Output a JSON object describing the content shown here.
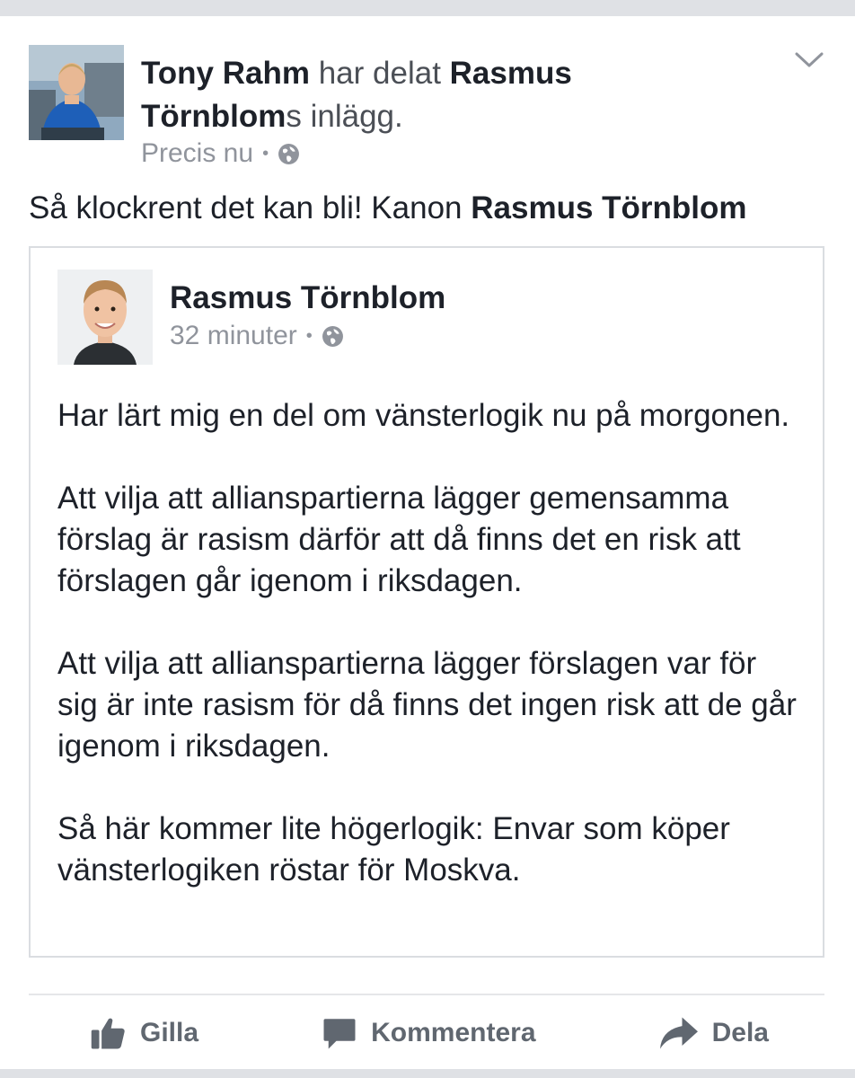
{
  "post": {
    "author": "Tony Rahm",
    "shared_word": " har delat ",
    "shared_from": "Rasmus Törnblom",
    "shared_suffix": "s inlägg.",
    "timestamp": "Precis nu",
    "dot": "•",
    "status_text": "Så klockrent det kan bli! Kanon ",
    "status_mention": "Rasmus Törnblom",
    "privacy_icon": "globe-icon",
    "menu_icon": "chevron-down-icon"
  },
  "shared_post": {
    "author": "Rasmus Törnblom",
    "timestamp": "32 minuter",
    "dot": "•",
    "paragraphs": [
      "Har lärt mig en del om vänsterlogik nu på morgonen.",
      "Att vilja att allianspartierna lägger gemensamma förslag är rasism därför att då finns det en risk att förslagen går igenom i riksdagen.",
      "Att vilja att allianspartierna lägger förslagen var för sig är inte rasism för då finns det ingen risk att de går igenom i riksdagen.",
      "Så här kommer lite högerlogik: Envar som köper vänsterlogiken röstar för Moskva."
    ]
  },
  "actions": {
    "like": "Gilla",
    "comment": "Kommentera",
    "share": "Dela"
  },
  "colors": {
    "text": "#1d2129",
    "secondary": "#90949c",
    "action": "#606770",
    "border": "#dadde1"
  }
}
